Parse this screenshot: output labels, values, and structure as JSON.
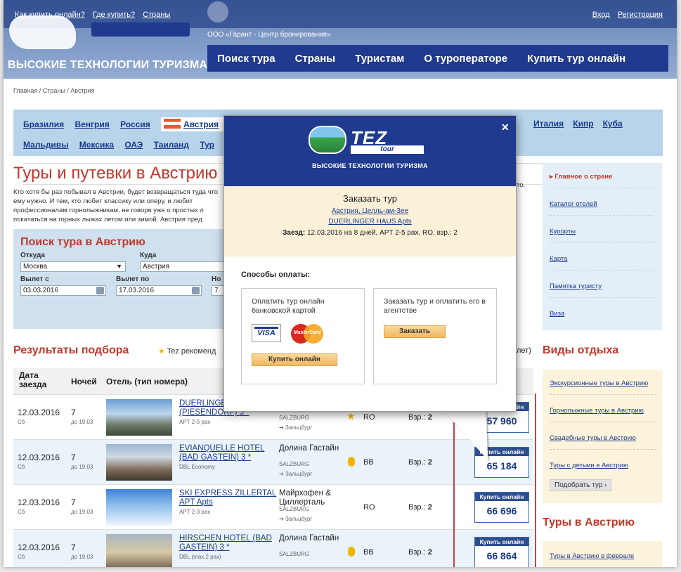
{
  "header": {
    "top_links": [
      "Как купить онлайн?",
      "Где купить?",
      "Страны"
    ],
    "auth_links": [
      "Вход",
      "Регистрация"
    ],
    "tagline": "ВЫСОКИЕ ТЕХНОЛОГИИ ТУРИЗМА",
    "org_line": "ООО «Гарант - Центр бронирования»",
    "nav": [
      "Поиск тура",
      "Страны",
      "Туристам",
      "О туроператоре",
      "Купить тур онлайн"
    ]
  },
  "breadcrumb": "Главная / Страны / Австрия",
  "countries": {
    "row1": [
      "Бразилия",
      "Венгрия",
      "Россия",
      "Австрия"
    ],
    "row1_right": [
      "Италия",
      "Кипр",
      "Куба"
    ],
    "row2": [
      "Мальдивы",
      "Мексика",
      "ОАЭ",
      "Таиланд",
      "Тур"
    ]
  },
  "page_title": "Туры и путевки в Австрию",
  "intro": "Кто хотя бы раз побывал в Австрии, будет возвращаться туда что ему нужно. И тем, кто любит классику или оперу, и любит профессионалам горнолыжникам, не говоря уже о простых л покататься на горных лыжах летом или зимой. Австрия пред",
  "intro_right": "то,",
  "search": {
    "title": "Поиск тура в Австрию",
    "from_label": "Откуда",
    "from_value": "Москва",
    "to_label": "Куда",
    "to_value": "Австрия",
    "depart_from_label": "Вылет с",
    "depart_from_value": "03.03.2016",
    "depart_to_label": "Вылет по",
    "depart_to_value": "17.03.2016",
    "nights_label": "Но",
    "nights_value": "7"
  },
  "results": {
    "title": "Результаты подбора",
    "tez_rec": "Tez рекоменд",
    "right_hint": "лет)",
    "columns": [
      "Дата заезда",
      "Ночей",
      "Отель (тип номера)"
    ],
    "rows": [
      {
        "date": "12.03.2016",
        "dow": "Сб",
        "nights": "7",
        "till": "до 19.03",
        "hotel": "DUERLINGER HAUS Apts (PIESENDORF) 3 *",
        "room": "APT 2-5 pax",
        "region": "",
        "region_sub": "SALZBURG",
        "transfer": "Зальцбург",
        "meal": "RO",
        "pax": "2",
        "price": "57 960",
        "badge": "star"
      },
      {
        "date": "12.03.2016",
        "dow": "Сб",
        "nights": "7",
        "till": "до 19.03",
        "hotel": "EVIANQUELLE HOTEL (BAD GASTEIN) 3 *",
        "room": "DBL Economy",
        "region": "Долина Гастайн",
        "region_sub": "SALZBURG",
        "transfer": "Зальцбург",
        "meal": "BB",
        "pax": "2",
        "price": "65 184",
        "badge": "medal"
      },
      {
        "date": "12.03.2016",
        "dow": "Сб",
        "nights": "7",
        "till": "до 19.03",
        "hotel": "SKI EXPRESS ZILLERTAL APT Apts",
        "room": "APT 2-3 pax",
        "region": "Майрхофен & Циллерталь",
        "region_sub": "SALZBURG",
        "transfer": "Зальцбург",
        "meal": "RO",
        "pax": "2",
        "price": "66 696",
        "badge": ""
      },
      {
        "date": "12.03.2016",
        "dow": "Сб",
        "nights": "7",
        "till": "до 19.03",
        "hotel": "HIRSCHEN HOTEL (BAD GASTEIN) 3 *",
        "room": "DBL (max.2 pax)",
        "region": "Долина Гастайн",
        "region_sub": "SALZBURG",
        "transfer": "",
        "meal": "BB",
        "pax": "2",
        "price": "66 864",
        "badge": "medal"
      }
    ],
    "buy_label": "Купить онлайн",
    "pax_prefix": "Взр.:"
  },
  "right_menu": [
    "Главное о стране",
    "Каталог отелей",
    "Курорты",
    "Карта",
    "Памятка туристу",
    "Виза"
  ],
  "vidy": {
    "title": "Виды отдыха",
    "items": [
      "Экскурсионные туры в Австрию",
      "Горнолыжные туры в Австрию",
      "Свадебные туры в Австрию",
      "Туры с детьми в Австрию"
    ],
    "pick": "Подобрать тур ›"
  },
  "tury": {
    "title": "Туры в Австрию",
    "item": "Туры в Австрию в феврале"
  },
  "modal": {
    "close": "×",
    "logo_tez": "TEZ",
    "logo_tour": "tour",
    "slogan": "ВЫСОКИЕ ТЕХНОЛОГИИ ТУРИЗМА",
    "order_title": "Заказать тур",
    "location_link": "Австрия, Целль-ам-Зее",
    "hotel_link": "DUERLINGER HAUS Apts",
    "details_label": "Заезд:",
    "details": "12.03.2016 на 8 дней, APT 2-5 pax, RO, взр.: 2",
    "payment_title": "Способы оплаты:",
    "online_desc": "Оплатить тур онлайн банковской картой",
    "online_btn": "Купить онлайн",
    "agency_desc": "Заказать тур и оплатить его в агентстве",
    "agency_btn": "Заказать",
    "visa": "VISA",
    "mastercard": "MasterCard"
  }
}
